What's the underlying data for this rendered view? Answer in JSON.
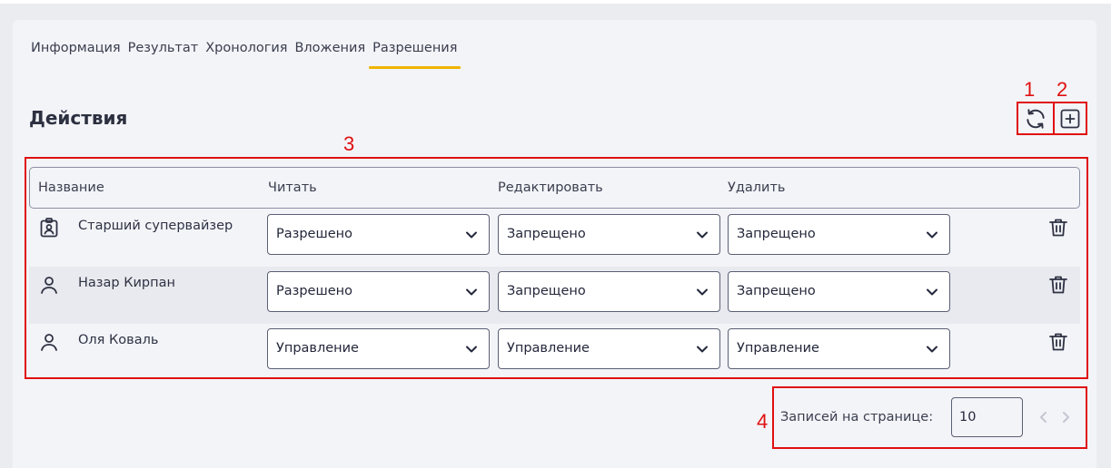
{
  "tabs": [
    "Информация",
    "Результат",
    "Хронология",
    "Вложения",
    "Разрешения"
  ],
  "active_tab": "Разрешения",
  "section_title": "Действия",
  "annotations": [
    "1",
    "2",
    "3",
    "4"
  ],
  "table": {
    "headers": [
      "Название",
      "Читать",
      "Редактировать",
      "Удалить"
    ],
    "rows": [
      {
        "icon": "badge-icon",
        "name": "Старший супервайзер",
        "read": "Разрешено",
        "edit": "Запрещено",
        "delete": "Запрещено"
      },
      {
        "icon": "user-icon",
        "name": "Назар Кирпан",
        "read": "Разрешено",
        "edit": "Запрещено",
        "delete": "Запрещено"
      },
      {
        "icon": "user-icon",
        "name": "Оля Коваль",
        "read": "Управление",
        "edit": "Управление",
        "delete": "Управление"
      }
    ]
  },
  "pagination": {
    "label": "Записей на странице:",
    "page_size": "10"
  },
  "colors": {
    "accent": "#f0b400",
    "annotation": "#e01010",
    "background": "#f3f4f8"
  }
}
